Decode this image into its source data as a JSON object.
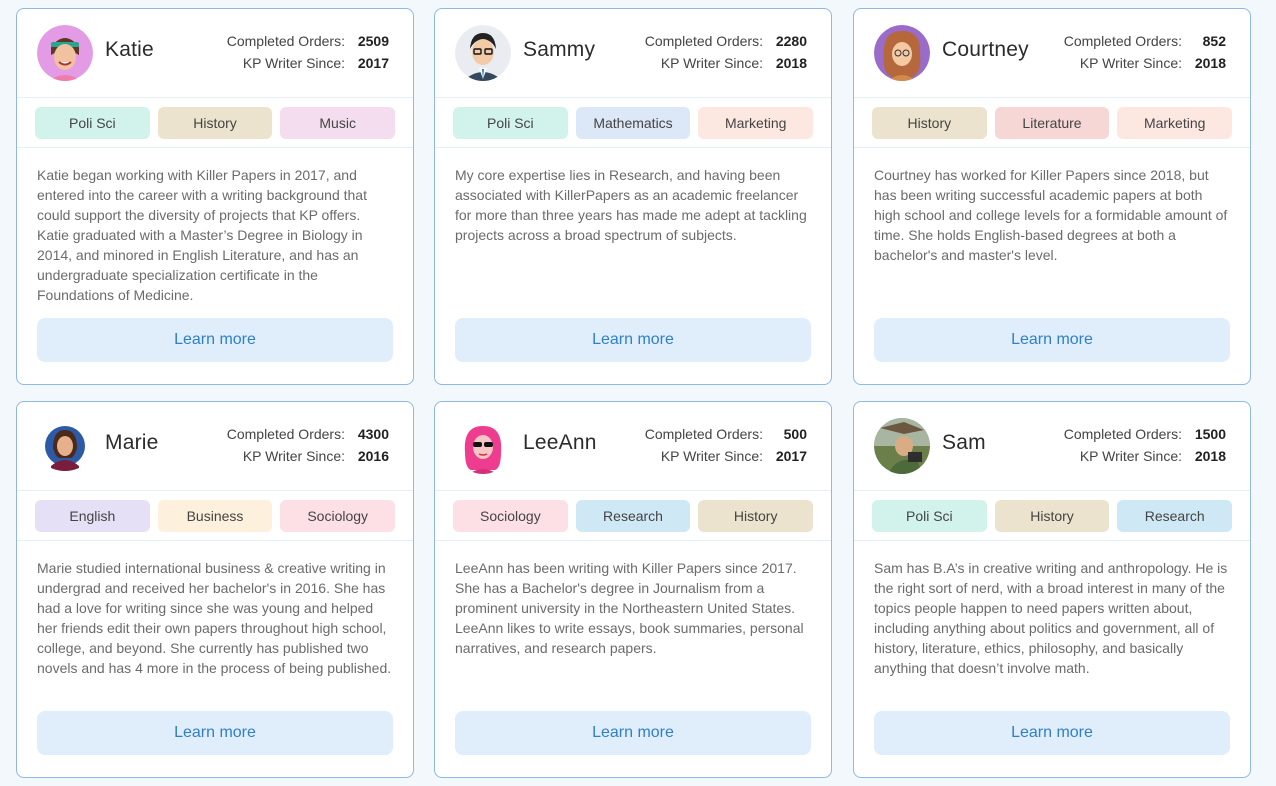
{
  "labels": {
    "completed_orders": "Completed Orders:",
    "writer_since": "KP Writer Since:",
    "learn_more": "Learn more"
  },
  "tag_colors": {
    "Poli Sci": "#d2f3ec",
    "History": "#ebe3cd",
    "Music": "#f4ddef",
    "Mathematics": "#dce7f8",
    "Marketing": "#fde8e1",
    "Literature": "#f6d7d5",
    "English": "#e6e0f6",
    "Business": "#fdf0dc",
    "Sociology": "#fde0e6",
    "Research": "#cfe8f5"
  },
  "writers": [
    {
      "name": "Katie",
      "orders": "2509",
      "since": "2017",
      "tags": [
        "Poli Sci",
        "History",
        "Music"
      ],
      "bio": "Katie began working with Killer Papers in 2017, and entered into the career with a writing background that could support the diversity of projects that KP offers. Katie graduated with a Master’s Degree in Biology in 2014, and minored in English Literature, and has an undergraduate specialization certificate in the Foundations of Medicine."
    },
    {
      "name": "Sammy",
      "orders": "2280",
      "since": "2018",
      "tags": [
        "Poli Sci",
        "Mathematics",
        "Marketing"
      ],
      "bio": "My core expertise lies in Research, and having been associated with KillerPapers as an academic freelancer for more than three years has made me adept at tackling projects across a broad spectrum of subjects."
    },
    {
      "name": "Courtney",
      "orders": "852",
      "since": "2018",
      "tags": [
        "History",
        "Literature",
        "Marketing"
      ],
      "bio": "Courtney has worked for Killer Papers since 2018, but has been writing successful academic papers at both high school and college levels for a formidable amount of time. She holds English-based degrees at both a bachelor's and master's level."
    },
    {
      "name": "Marie",
      "orders": "4300",
      "since": "2016",
      "tags": [
        "English",
        "Business",
        "Sociology"
      ],
      "bio": "Marie studied international business & creative writing in undergrad and received her bachelor's in 2016. She has had a love for writing since she was young and helped her friends edit their own papers throughout high school, college, and beyond. She currently has published two novels and has 4 more in the process of being published."
    },
    {
      "name": "LeeAnn",
      "orders": "500",
      "since": "2017",
      "tags": [
        "Sociology",
        "Research",
        "History"
      ],
      "bio": "LeeAnn has been writing with Killer Papers since 2017. She has a Bachelor's degree in Journalism from a prominent university in the Northeastern United States. LeeAnn likes to write essays, book summaries, personal narratives, and research papers."
    },
    {
      "name": "Sam",
      "orders": "1500",
      "since": "2018",
      "tags": [
        "Poli Sci",
        "History",
        "Research"
      ],
      "bio": "Sam has B.A’s in creative writing and anthropology. He is the right sort of nerd, with a broad interest in many of the topics people happen to need papers written about, including anything about politics and government, all of history, literature, ethics, philosophy, and basically anything that doesn’t involve math."
    }
  ]
}
